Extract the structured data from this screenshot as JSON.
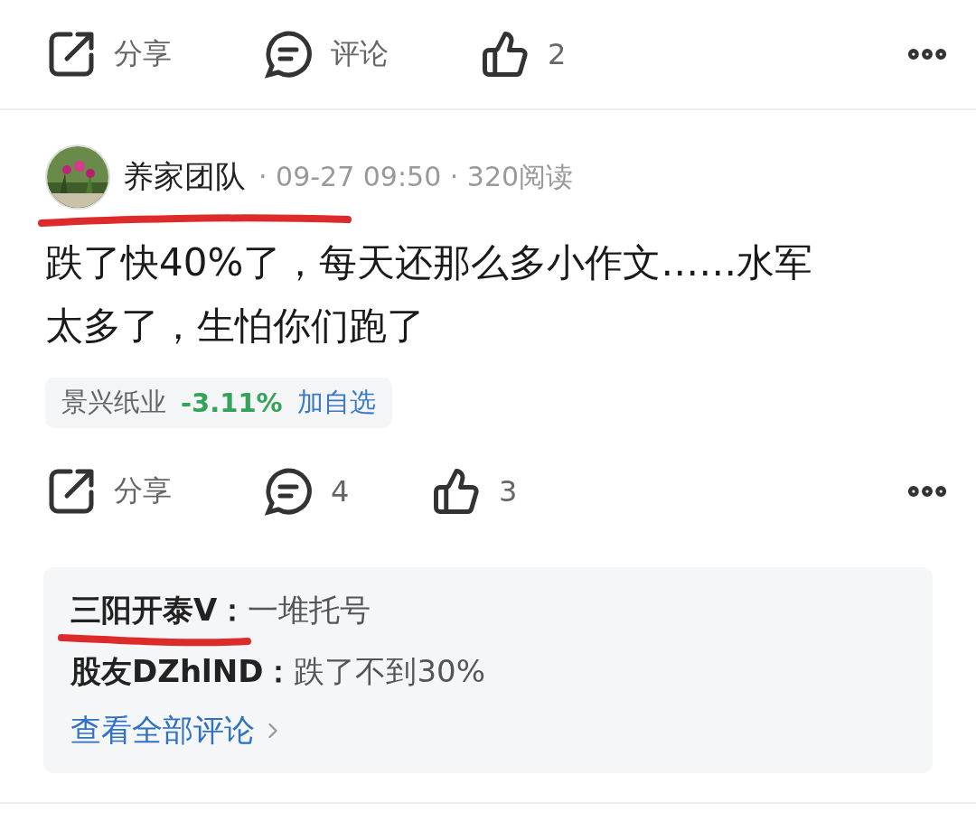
{
  "top_actions": {
    "share": "分享",
    "comment": "评论",
    "likes": "2"
  },
  "post": {
    "author": "养家团队",
    "meta": "· 09-27 09:50 · 320阅读",
    "text": "跌了快40%了，每天还那么多小作文……水军太多了，生怕你们跑了",
    "stock": {
      "name": "景兴纸业",
      "change": "-3.11%",
      "action": "加自选"
    },
    "actions": {
      "share": "分享",
      "comments": "4",
      "likes": "3"
    },
    "comments": [
      {
        "user": "三阳开泰V：",
        "text": "一堆托号"
      },
      {
        "user": "股友DZhlND：",
        "text": "跌了不到30%"
      }
    ],
    "view_all": "查看全部评论"
  }
}
